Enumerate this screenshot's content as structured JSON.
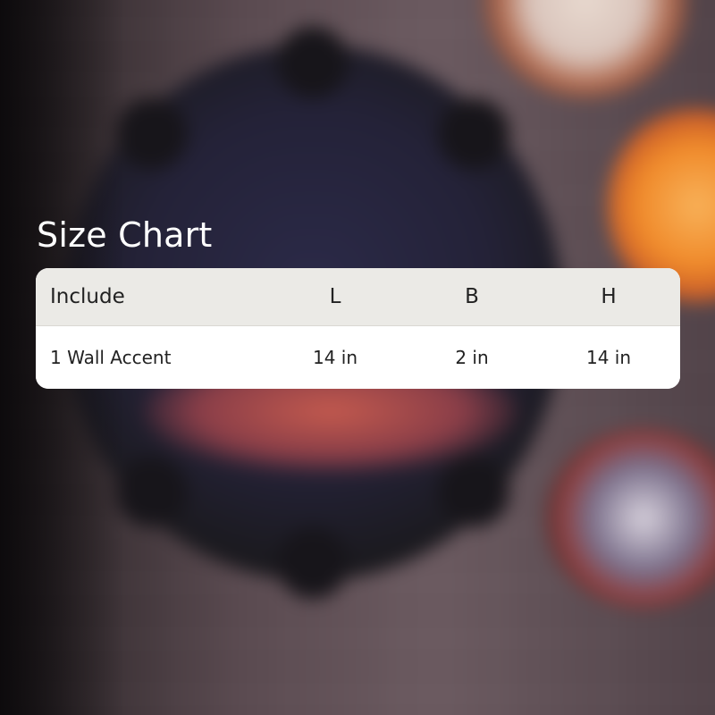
{
  "title": "Size Chart",
  "table": {
    "headers": [
      "Include",
      "L",
      "B",
      "H"
    ],
    "rows": [
      [
        "1 Wall Accent",
        "14 in",
        "2 in",
        "14 in"
      ]
    ]
  },
  "colors": {
    "header_bg": "#ebeae6",
    "row_bg": "#ffffff",
    "text": "#222222",
    "title_text": "#ffffff"
  }
}
